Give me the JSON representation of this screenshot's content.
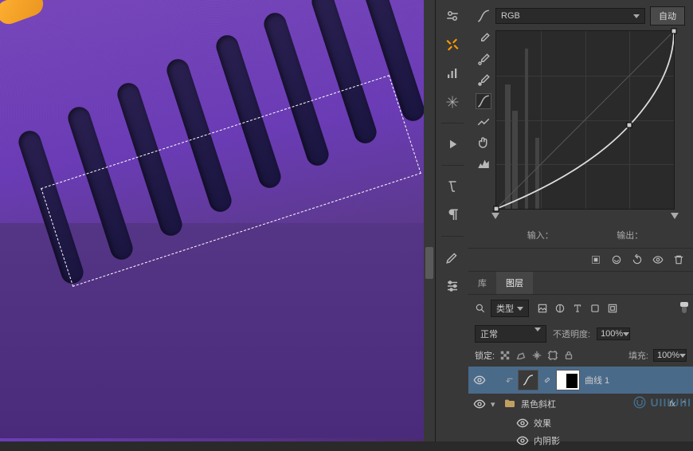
{
  "curves": {
    "channel": "RGB",
    "auto_label": "自动",
    "input_label": "输入：",
    "output_label": "输出："
  },
  "chart_data": {
    "type": "line",
    "title": "",
    "xlabel": "输入",
    "ylabel": "输出",
    "xlim": [
      0,
      255
    ],
    "ylim": [
      0,
      255
    ],
    "series": [
      {
        "name": "baseline",
        "x": [
          0,
          255
        ],
        "y": [
          0,
          255
        ]
      },
      {
        "name": "curve",
        "x": [
          0,
          191,
          255
        ],
        "y": [
          0,
          120,
          255
        ]
      }
    ],
    "points": [
      {
        "x": 0,
        "y": 0
      },
      {
        "x": 191,
        "y": 120
      },
      {
        "x": 255,
        "y": 255
      }
    ]
  },
  "layers_panel": {
    "tabs": {
      "library": "库",
      "layers": "图层"
    },
    "filter_label": "类型",
    "blend_mode": "正常",
    "opacity_label": "不透明度:",
    "opacity_value": "100%",
    "lock_label": "锁定:",
    "fill_label": "填充:",
    "fill_value": "100%"
  },
  "layers": {
    "curves_layer": "曲线 1",
    "group_name": "黑色斜杠",
    "effects_label": "效果",
    "inner_shadow": "内阴影",
    "fx_badge": "fx"
  },
  "watermark": "UIIIUIII"
}
